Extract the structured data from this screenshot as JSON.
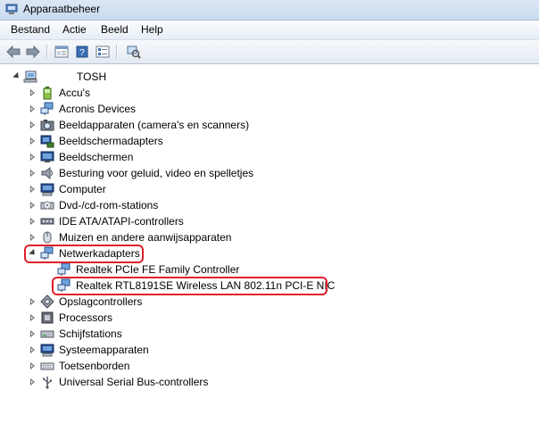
{
  "window": {
    "title": "Apparaatbeheer"
  },
  "menu": [
    "Bestand",
    "Actie",
    "Beeld",
    "Help"
  ],
  "toolbar": {
    "buttons": [
      "back-arrow-icon",
      "forward-arrow-icon",
      "properties-icon",
      "help-book-icon",
      "properties-list-icon",
      "scan-hardware-icon"
    ]
  },
  "tree": {
    "root": "TOSH",
    "categories": [
      {
        "label": "Accu's",
        "icon": "battery-icon"
      },
      {
        "label": "Acronis Devices",
        "icon": "network-icon"
      },
      {
        "label": "Beeldapparaten (camera's en scanners)",
        "icon": "camera-icon"
      },
      {
        "label": "Beeldschermadapters",
        "icon": "display-adapter-icon"
      },
      {
        "label": "Beeldschermen",
        "icon": "monitor-icon"
      },
      {
        "label": "Besturing voor geluid, video en spelletjes",
        "icon": "speaker-icon"
      },
      {
        "label": "Computer",
        "icon": "computer-icon"
      },
      {
        "label": "Dvd-/cd-rom-stations",
        "icon": "dvd-drive-icon"
      },
      {
        "label": "IDE ATA/ATAPI-controllers",
        "icon": "ide-controller-icon"
      },
      {
        "label": "Muizen en andere aanwijsapparaten",
        "icon": "mouse-icon"
      },
      {
        "label": "Netwerkadapters",
        "icon": "network-adapter-icon",
        "expanded": true,
        "children": [
          {
            "label": "Realtek PCIe FE Family Controller",
            "icon": "network-adapter-icon"
          },
          {
            "label": "Realtek RTL8191SE Wireless LAN 802.11n PCI-E NIC",
            "icon": "network-adapter-icon"
          }
        ]
      },
      {
        "label": "Opslagcontrollers",
        "icon": "storage-controller-icon"
      },
      {
        "label": "Processors",
        "icon": "processor-icon"
      },
      {
        "label": "Schijfstations",
        "icon": "disk-drive-icon"
      },
      {
        "label": "Systeemapparaten",
        "icon": "system-device-icon"
      },
      {
        "label": "Toetsenborden",
        "icon": "keyboard-icon"
      },
      {
        "label": "Universal Serial Bus-controllers",
        "icon": "usb-icon"
      }
    ]
  },
  "colors": {
    "highlight": "#e0202a",
    "titlebar": "#c9dbef"
  }
}
